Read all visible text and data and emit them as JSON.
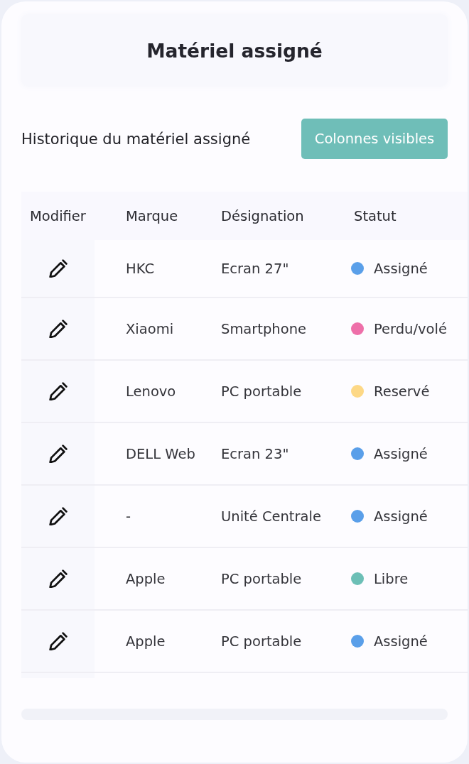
{
  "header": {
    "title": "Matériel assigné"
  },
  "toolbar": {
    "subtitle": "Historique du matériel assigné",
    "button": "Colonnes visibles"
  },
  "table": {
    "columns": [
      "Modifier",
      "Marque",
      "Désignation",
      "Statut"
    ],
    "rows": [
      {
        "brand": "HKC",
        "designation": "Ecran 27\"",
        "status": "Assigné",
        "color": "#5a9fe9"
      },
      {
        "brand": "Xiaomi",
        "designation": "Smartphone",
        "status": "Perdu/volé",
        "color": "#ee6fa9"
      },
      {
        "brand": "Lenovo",
        "designation": "PC portable",
        "status": "Reservé",
        "color": "#fdd886"
      },
      {
        "brand": "DELL Web",
        "designation": "Ecran 23\"",
        "status": "Assigné",
        "color": "#5a9fe9"
      },
      {
        "brand": "-",
        "designation": "Unité Centrale",
        "status": "Assigné",
        "color": "#5a9fe9"
      },
      {
        "brand": "Apple",
        "designation": "PC portable",
        "status": "Libre",
        "color": "#6cbfb6"
      },
      {
        "brand": "Apple",
        "designation": "PC portable",
        "status": "Assigné",
        "color": "#5a9fe9"
      }
    ]
  }
}
